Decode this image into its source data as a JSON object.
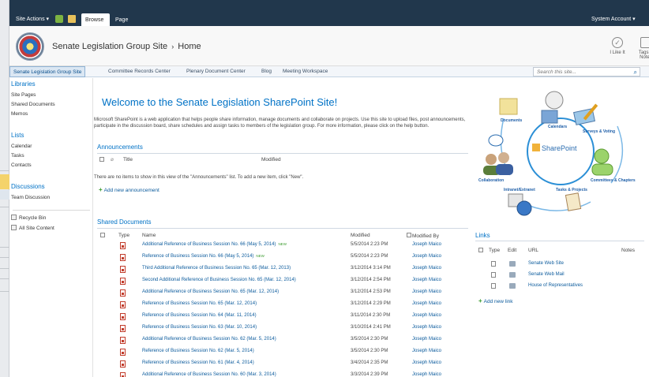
{
  "ribbon": {
    "site_actions": "Site Actions ▾",
    "tabs": [
      "Browse",
      "Page"
    ],
    "user": "System Account ▾"
  },
  "title_area": {
    "site_title": "Senate Legislation Group Site",
    "breadcrumb_sep": "›",
    "page": "Home",
    "like_label": "I Like It",
    "tags_label": "Tags & Notes"
  },
  "topnav": {
    "items": [
      "Senate Legislation Group Site",
      "Committee Records Center",
      "Plenary Document Center",
      "Blog",
      "Meeting Workspace"
    ],
    "search_placeholder": "Search this site..."
  },
  "quick_launch": {
    "libraries_heading": "Libraries",
    "libraries": [
      "Site Pages",
      "Shared Documents",
      "Memos"
    ],
    "lists_heading": "Lists",
    "lists": [
      "Calendar",
      "Tasks",
      "Contacts"
    ],
    "discussions_heading": "Discussions",
    "discussions": [
      "Team Discussion"
    ],
    "recycle_bin": "Recycle Bin",
    "all_site_content": "All Site Content"
  },
  "welcome": {
    "title": "Welcome to the Senate Legislation SharePoint Site!",
    "text": "Microsoft SharePoint is a web application that helps people share information, manage documents and collaborate on projects. Use this site to upload files, post announcements, participate in the discussion board, share schedules and assign tasks to members of the legislation group. For more information, please click on the help button."
  },
  "announcements": {
    "title": "Announcements",
    "col_title": "Title",
    "col_modified": "Modified",
    "empty": "There are no items to show in this view of the \"Announcements\" list. To add a new item, click \"New\".",
    "add": "Add new announcement"
  },
  "documents": {
    "title": "Shared Documents",
    "col_type": "Type",
    "col_name": "Name",
    "col_modified": "Modified",
    "col_modified_by": "Modified By",
    "new_badge": "NEW",
    "rows": [
      {
        "name": "Additional Reference of Business Session No. 66 (May 5, 2014)",
        "modified": "5/5/2014 2:23 PM",
        "by": "Joseph Maico"
      },
      {
        "name": "Reference of Business Session No. 66 (May 5, 2014)",
        "modified": "5/5/2014 2:23 PM",
        "by": "Joseph Maico"
      },
      {
        "name": "Third Additional Reference of Business Session No. 65 (Mar. 12, 2013)",
        "modified": "3/12/2014 3:14 PM",
        "by": "Joseph Maico"
      },
      {
        "name": "Second Additional Reference of Business Session No. 65 (Mar. 12, 2014)",
        "modified": "3/12/2014 2:54 PM",
        "by": "Joseph Maico"
      },
      {
        "name": "Additional Reference of Business Session No. 65 (Mar. 12, 2014)",
        "modified": "3/12/2014 2:53 PM",
        "by": "Joseph Maico"
      },
      {
        "name": "Reference of Business Session No. 65 (Mar. 12, 2014)",
        "modified": "3/12/2014 2:29 PM",
        "by": "Joseph Maico"
      },
      {
        "name": "Reference of Business Session No. 64 (Mar. 11, 2014)",
        "modified": "3/11/2014 2:30 PM",
        "by": "Joseph Maico"
      },
      {
        "name": "Reference of Business Session No. 63 (Mar. 10, 2014)",
        "modified": "3/10/2014 2:41 PM",
        "by": "Joseph Maico"
      },
      {
        "name": "Additional Reference of Business Session No. 62 (Mar. 5, 2014)",
        "modified": "3/5/2014 2:30 PM",
        "by": "Joseph Maico"
      },
      {
        "name": "Reference of Business Session No. 62 (Mar. 5, 2014)",
        "modified": "3/5/2014 2:30 PM",
        "by": "Joseph Maico"
      },
      {
        "name": "Reference of Business Session No. 61 (Mar. 4, 2014)",
        "modified": "3/4/2014 2:35 PM",
        "by": "Joseph Maico"
      },
      {
        "name": "Additional Reference of Business Session No. 60 (Mar. 3, 2014)",
        "modified": "3/3/2014 2:39 PM",
        "by": "Joseph Maico"
      }
    ]
  },
  "diagram": {
    "center": "SharePoint",
    "labels": [
      "Documents",
      "Calendars",
      "Surveys & Voting",
      "Collaboration",
      "Committees & Chapters",
      "Intranet/Extranet",
      "Tasks & Projects"
    ]
  },
  "links": {
    "title": "Links",
    "col_type": "Type",
    "col_edit": "Edit",
    "col_url": "URL",
    "col_notes": "Notes",
    "rows": [
      "Senate Web Site",
      "Senate Web Mail",
      "House of Representatives"
    ],
    "add": "Add new link"
  }
}
